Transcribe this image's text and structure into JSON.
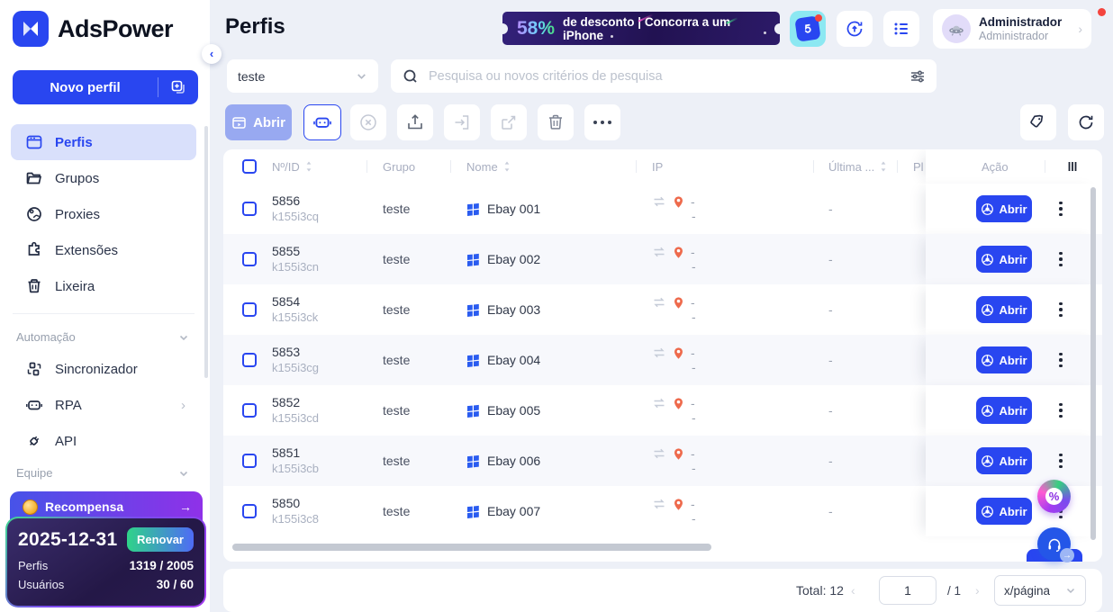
{
  "brand": {
    "name": "AdsPower"
  },
  "sidebar": {
    "new_profile_label": "Novo perfil",
    "items": [
      {
        "label": "Perfis"
      },
      {
        "label": "Grupos"
      },
      {
        "label": "Proxies"
      },
      {
        "label": "Extensões"
      },
      {
        "label": "Lixeira"
      }
    ],
    "automation_section": "Automação",
    "automation_items": [
      {
        "label": "Sincronizador"
      },
      {
        "label": "RPA"
      },
      {
        "label": "API"
      }
    ],
    "team_section": "Equipe"
  },
  "reward": {
    "banner_label": "Recompensa",
    "arrow": "→",
    "expiry_date": "2025-12-31",
    "renew_label": "Renovar",
    "profiles_label": "Perfis",
    "profiles_value": "1319 / 2005",
    "users_label": "Usuários",
    "users_value": "30 / 60"
  },
  "header": {
    "title": "Perfis",
    "promo": {
      "percent": "58%",
      "text": "de desconto | Concorra a um iPhone"
    },
    "account": {
      "name": "Administrador",
      "role": "Administrador",
      "chevron": "›"
    }
  },
  "filters": {
    "group_value": "teste",
    "search_placeholder": "Pesquisa ou novos critérios de pesquisa"
  },
  "toolbar": {
    "open_label": "Abrir"
  },
  "table": {
    "headers": {
      "no_id": "Nº/ID",
      "group": "Grupo",
      "name": "Nome",
      "ip": "IP",
      "last": "Última ...",
      "platform": "Pl",
      "action": "Ação"
    },
    "open_label": "Abrir",
    "rows": [
      {
        "no": "5856",
        "id": "k155i3cq",
        "group": "teste",
        "name": "Ebay 001",
        "ip": "-",
        "ip_sub": "-",
        "last": "-"
      },
      {
        "no": "5855",
        "id": "k155i3cn",
        "group": "teste",
        "name": "Ebay 002",
        "ip": "-",
        "ip_sub": "-",
        "last": "-"
      },
      {
        "no": "5854",
        "id": "k155i3ck",
        "group": "teste",
        "name": "Ebay 003",
        "ip": "-",
        "ip_sub": "-",
        "last": "-"
      },
      {
        "no": "5853",
        "id": "k155i3cg",
        "group": "teste",
        "name": "Ebay 004",
        "ip": "-",
        "ip_sub": "-",
        "last": "-"
      },
      {
        "no": "5852",
        "id": "k155i3cd",
        "group": "teste",
        "name": "Ebay 005",
        "ip": "-",
        "ip_sub": "-",
        "last": "-"
      },
      {
        "no": "5851",
        "id": "k155i3cb",
        "group": "teste",
        "name": "Ebay 006",
        "ip": "-",
        "ip_sub": "-",
        "last": "-"
      },
      {
        "no": "5850",
        "id": "k155i3c8",
        "group": "teste",
        "name": "Ebay 007",
        "ip": "-",
        "ip_sub": "-",
        "last": "-"
      }
    ]
  },
  "pagination": {
    "total": "Total: 12",
    "prev": "‹",
    "page": "1",
    "of_pages": "/ 1",
    "next": "›",
    "per_page": "x/página"
  },
  "colors": {
    "accent": "#2946f0",
    "accent_disabled": "#98a9f1",
    "pin": "#ee6a4c",
    "teal_button": "#8ce8f2",
    "row_alt": "#f7f8fc",
    "notification": "#f4443e"
  }
}
